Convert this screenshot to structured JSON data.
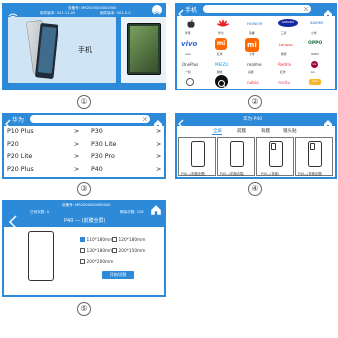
{
  "p1": {
    "device_id": "设备号: MR2000000000000",
    "software_ver": "软件版本: V21.11.03",
    "firmware_ver": "固件版本: V01.0.0",
    "label": "手机",
    "badge": "①"
  },
  "p2": {
    "search_label": "手机",
    "brands_row1": [
      "Apple",
      "HUAWEI",
      "HONOR",
      "SAMSUNG",
      "Xiaomi"
    ],
    "brands_row2": [
      "荣耀",
      "vivo",
      "OPPO",
      "三星",
      "华为"
    ],
    "brands_row3": [
      "vivo",
      "小米",
      "mi",
      "OPPO",
      "ONEPLUS"
    ],
    "brands_row4": [
      "一加",
      "Meizu",
      "魅族",
      "realme",
      "一加"
    ],
    "brands_row5": [
      "Motorola",
      "black",
      "nubia",
      "meizu",
      "other"
    ],
    "badge": "②"
  },
  "p3": {
    "search_label": "华为",
    "rows": [
      {
        "left": "P10 Plus",
        "right": "P30"
      },
      {
        "left": "P20",
        "right": "P30 Lite"
      },
      {
        "left": "P20 Lite",
        "right": "P30 Pro"
      },
      {
        "left": "P20 Plus",
        "right": "P40"
      }
    ],
    "arrow": ">",
    "badge": "③"
  },
  "p4": {
    "title": "华为-P40",
    "tabs": [
      "全屏",
      "前膜",
      "背膜",
      "镜头贴"
    ],
    "captions": [
      "P40—(前膜全屏)",
      "P40—(前膜合集)",
      "P40—(背膜)",
      "P40—(背膜全屏)"
    ],
    "badge": "④"
  },
  "p5": {
    "device_id": "设备号: MR2000000000000",
    "remaining": "已有次数: 0",
    "cut_count": "剩余次数: 228",
    "title": "P40 — (前膜全屏)",
    "options": [
      "110*180mm",
      "120*180mm",
      "130*180mm",
      "200*150mm",
      "200*200mm"
    ],
    "start_label": "开始切割",
    "badge": "⑤"
  },
  "colors": {
    "primary": "#2d8ad9",
    "panel_bg": "#2d8ad9"
  }
}
